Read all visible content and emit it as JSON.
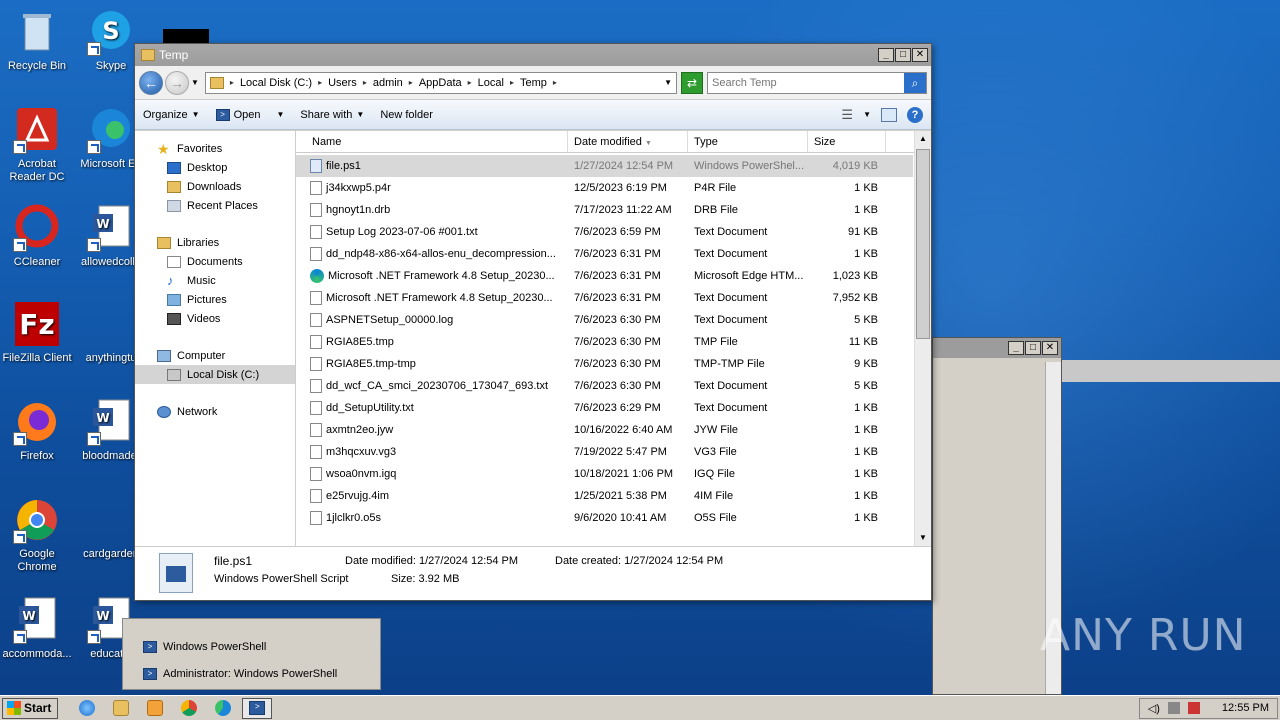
{
  "desktop": {
    "icons": [
      {
        "label": "Recycle Bin"
      },
      {
        "label": "Skype"
      },
      {
        "label": "Acrobat Reader DC"
      },
      {
        "label": "Microsoft Ed"
      },
      {
        "label": "CCleaner"
      },
      {
        "label": "allowedcolle"
      },
      {
        "label": "FileZilla Client"
      },
      {
        "label": "anythingtu"
      },
      {
        "label": "Firefox"
      },
      {
        "label": "bloodmade."
      },
      {
        "label": "Google Chrome"
      },
      {
        "label": "cardgarden"
      },
      {
        "label": "accommoda..."
      },
      {
        "label": "educatio"
      }
    ]
  },
  "window": {
    "title": "Temp",
    "breadcrumb": [
      "Local Disk (C:)",
      "Users",
      "admin",
      "AppData",
      "Local",
      "Temp"
    ],
    "search_placeholder": "Search Temp",
    "toolbar": {
      "organize": "Organize",
      "open": "Open",
      "share_with": "Share with",
      "new_folder": "New folder"
    },
    "nav": {
      "favorites": "Favorites",
      "desktop": "Desktop",
      "downloads": "Downloads",
      "recent_places": "Recent Places",
      "libraries": "Libraries",
      "documents": "Documents",
      "music": "Music",
      "pictures": "Pictures",
      "videos": "Videos",
      "computer": "Computer",
      "local_disk": "Local Disk (C:)",
      "network": "Network"
    },
    "columns": {
      "name": "Name",
      "date_modified": "Date modified",
      "type": "Type",
      "size": "Size"
    },
    "files": [
      {
        "name": "file.ps1",
        "date": "1/27/2024 12:54 PM",
        "type": "Windows PowerShel...",
        "size": "4,019 KB",
        "icon": "powershell-script"
      },
      {
        "name": "j34kxwp5.p4r",
        "date": "12/5/2023 6:19 PM",
        "type": "P4R File",
        "size": "1 KB",
        "icon": "file"
      },
      {
        "name": "hgnoyt1n.drb",
        "date": "7/17/2023 11:22 AM",
        "type": "DRB File",
        "size": "1 KB",
        "icon": "file"
      },
      {
        "name": "Setup Log 2023-07-06 #001.txt",
        "date": "7/6/2023 6:59 PM",
        "type": "Text Document",
        "size": "91 KB",
        "icon": "file"
      },
      {
        "name": "dd_ndp48-x86-x64-allos-enu_decompression...",
        "date": "7/6/2023 6:31 PM",
        "type": "Text Document",
        "size": "1 KB",
        "icon": "file"
      },
      {
        "name": "Microsoft .NET Framework 4.8 Setup_20230...",
        "date": "7/6/2023 6:31 PM",
        "type": "Microsoft Edge HTM...",
        "size": "1,023 KB",
        "icon": "edge"
      },
      {
        "name": "Microsoft .NET Framework 4.8 Setup_20230...",
        "date": "7/6/2023 6:31 PM",
        "type": "Text Document",
        "size": "7,952 KB",
        "icon": "file"
      },
      {
        "name": "ASPNETSetup_00000.log",
        "date": "7/6/2023 6:30 PM",
        "type": "Text Document",
        "size": "5 KB",
        "icon": "file"
      },
      {
        "name": "RGIA8E5.tmp",
        "date": "7/6/2023 6:30 PM",
        "type": "TMP File",
        "size": "11 KB",
        "icon": "file"
      },
      {
        "name": "RGIA8E5.tmp-tmp",
        "date": "7/6/2023 6:30 PM",
        "type": "TMP-TMP File",
        "size": "9 KB",
        "icon": "file"
      },
      {
        "name": "dd_wcf_CA_smci_20230706_173047_693.txt",
        "date": "7/6/2023 6:30 PM",
        "type": "Text Document",
        "size": "5 KB",
        "icon": "file"
      },
      {
        "name": "dd_SetupUtility.txt",
        "date": "7/6/2023 6:29 PM",
        "type": "Text Document",
        "size": "1 KB",
        "icon": "file"
      },
      {
        "name": "axmtn2eo.jyw",
        "date": "10/16/2022 6:40 AM",
        "type": "JYW File",
        "size": "1 KB",
        "icon": "file"
      },
      {
        "name": "m3hqcxuv.vg3",
        "date": "7/19/2022 5:47 PM",
        "type": "VG3 File",
        "size": "1 KB",
        "icon": "file"
      },
      {
        "name": "wsoa0nvm.igq",
        "date": "10/18/2021 1:06 PM",
        "type": "IGQ File",
        "size": "1 KB",
        "icon": "file"
      },
      {
        "name": "e25rvujg.4im",
        "date": "1/25/2021 5:38 PM",
        "type": "4IM File",
        "size": "1 KB",
        "icon": "file"
      },
      {
        "name": "1jlclkr0.o5s",
        "date": "9/6/2020 10:41 AM",
        "type": "O5S File",
        "size": "1 KB",
        "icon": "file"
      }
    ],
    "details": {
      "filename": "file.ps1",
      "filetype": "Windows PowerShell Script",
      "date_modified": "Date modified: 1/27/2024 12:54 PM",
      "date_created": "Date created: 1/27/2024 12:54 PM",
      "size": "Size: 3.92 MB"
    }
  },
  "jumplist": {
    "items": [
      "Windows PowerShell",
      "Administrator: Windows PowerShell"
    ]
  },
  "taskbar": {
    "start": "Start",
    "clock": "12:55 PM"
  },
  "watermark": "ANY RUN"
}
